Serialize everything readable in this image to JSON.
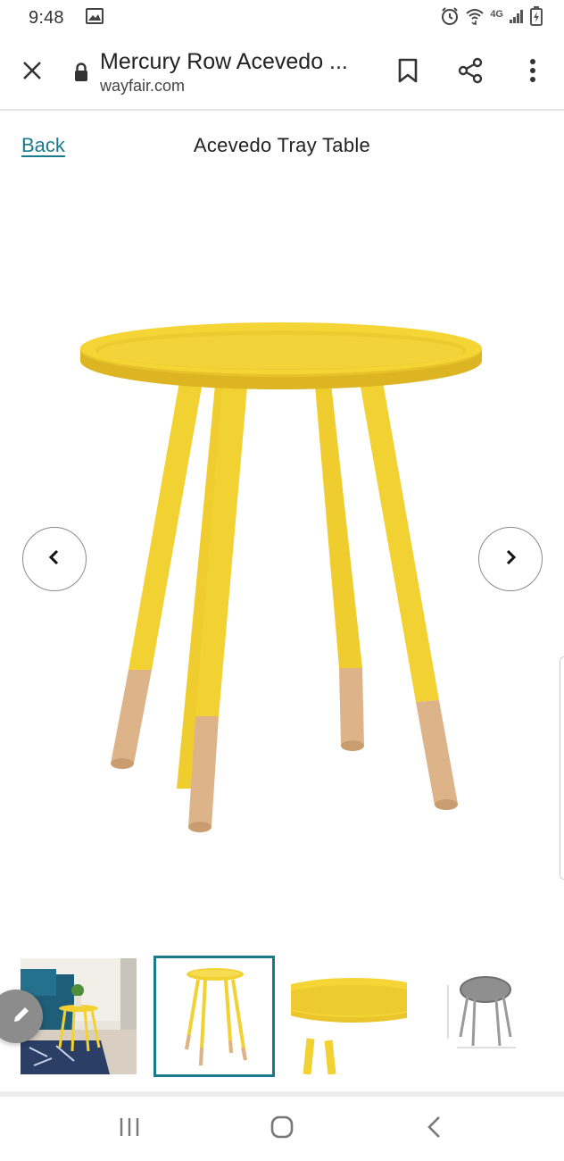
{
  "status_bar": {
    "time": "9:48",
    "network": "4G",
    "icons": [
      "image-icon",
      "alarm-icon",
      "wifi-icon",
      "signal-icon",
      "battery-icon"
    ]
  },
  "browser": {
    "page_title": "Mercury Row Acevedo ...",
    "domain": "wayfair.com",
    "icons": [
      "close-icon",
      "lock-icon",
      "bookmark-icon",
      "share-icon",
      "more-vert-icon"
    ]
  },
  "product": {
    "back_label": "Back",
    "title": "Acevedo Tray Table",
    "colors": {
      "table_yellow": "#F2D133",
      "wood_leg": "#DDB48A",
      "link_teal": "#1A7A8A"
    }
  },
  "gallery": {
    "prev_icon": "chevron-left-icon",
    "next_icon": "chevron-right-icon",
    "thumbnails": [
      {
        "name": "lifestyle-room-photo",
        "selected": false
      },
      {
        "name": "front-view-photo",
        "selected": true
      },
      {
        "name": "tray-top-detail-photo",
        "selected": false
      },
      {
        "name": "dimensions-diagram",
        "selected": false
      }
    ]
  },
  "system_nav": {
    "icons": [
      "recents-icon",
      "home-icon",
      "back-icon"
    ]
  }
}
